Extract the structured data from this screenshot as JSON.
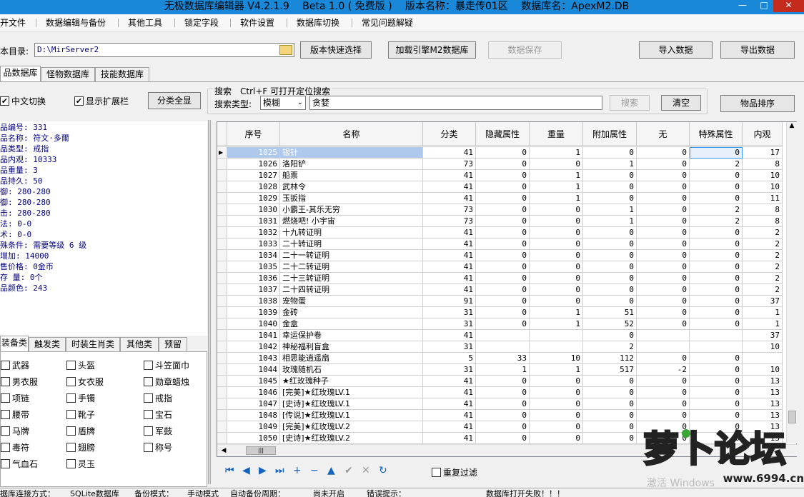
{
  "window": {
    "title": "无极数据库编辑器 V4.2.1.9　 Beta 1.0 ( 免费版 )　 版本名称：暴走传01区　 数据库名：ApexM2.DB",
    "minimize": "—",
    "maximize": "□",
    "close": "✕"
  },
  "menu": [
    "开文件",
    "数据编辑与备份",
    "其他工具",
    "锁定字段",
    "软件设置",
    "数据库切换",
    "常见问题解疑"
  ],
  "toolbar": {
    "dir_label": "本目录:",
    "dir_value": "D:\\MirServer2",
    "version_button": "版本快速选择",
    "load_button": "加载引擎M2数据库",
    "save_button": "数据保存",
    "import_button": "导入数据",
    "export_button": "导出数据"
  },
  "db_tabs": [
    "品数据库",
    "怪物数据库",
    "技能数据库"
  ],
  "options": {
    "chinese_toggle": "中文切换",
    "show_ext": "显示扩展栏",
    "expand_all": "分类全显"
  },
  "search": {
    "group_label": "搜索　Ctrl+F 可打开定位搜索",
    "type_label": "搜索类型:",
    "type_value": "模糊",
    "keyword": "贪婪",
    "search_button": "搜索",
    "clear_button": "清空",
    "sort_button": "物品排序"
  },
  "item_info": [
    "品编号: 331",
    "品名称: 符文·多爾",
    "品类型: 戒指",
    "品内观: 10333",
    "品重量: 3",
    "品持久: 50",
    "   御: 280-280",
    "   御: 280-280",
    "   击: 280-280",
    "   法: 0-0",
    "   术: 0-0",
    "殊条件: 需要等级 6 级",
    "  增加: 14000",
    "售价格: 0金币",
    " 存 量: 0个",
    "品颜色: 243"
  ],
  "category_tabs": [
    "装备类",
    "触发类",
    "时装生肖类",
    "其他类",
    "预留"
  ],
  "categories": [
    [
      "武器",
      "头盔",
      "斗笠面巾"
    ],
    [
      "男衣服",
      "女衣服",
      "勋章蜡烛"
    ],
    [
      "项链",
      "手镯",
      "戒指"
    ],
    [
      "腰带",
      "靴子",
      "宝石"
    ],
    [
      "马牌",
      "盾牌",
      "军鼓"
    ],
    [
      "毒符",
      "翅膀",
      "称号"
    ],
    [
      "气血石",
      "灵玉",
      ""
    ]
  ],
  "columns": [
    "序号",
    "名称",
    "分类",
    "隐藏属性",
    "重量",
    "附加属性",
    "无",
    "特殊属性",
    "内观"
  ],
  "rows": [
    [
      "1025",
      "银针",
      "41",
      "0",
      "1",
      "0",
      "0",
      "0",
      "17"
    ],
    [
      "1026",
      "洛阳铲",
      "73",
      "0",
      "0",
      "1",
      "0",
      "2",
      "8"
    ],
    [
      "1027",
      "船票",
      "41",
      "0",
      "1",
      "0",
      "0",
      "0",
      "10"
    ],
    [
      "1028",
      "武林令",
      "41",
      "0",
      "1",
      "0",
      "0",
      "0",
      "10"
    ],
    [
      "1029",
      "玉扳指",
      "41",
      "0",
      "1",
      "0",
      "0",
      "0",
      "11"
    ],
    [
      "1030",
      "小霸王-其乐无穷",
      "73",
      "0",
      "0",
      "1",
      "0",
      "2",
      "8"
    ],
    [
      "1031",
      "燃烧吧! 小宇宙",
      "73",
      "0",
      "0",
      "1",
      "0",
      "2",
      "8"
    ],
    [
      "1032",
      "十九转证明",
      "41",
      "0",
      "0",
      "0",
      "0",
      "0",
      "2"
    ],
    [
      "1033",
      "二十转证明",
      "41",
      "0",
      "0",
      "0",
      "0",
      "0",
      "2"
    ],
    [
      "1034",
      "二十一转证明",
      "41",
      "0",
      "0",
      "0",
      "0",
      "0",
      "2"
    ],
    [
      "1035",
      "二十二转证明",
      "41",
      "0",
      "0",
      "0",
      "0",
      "0",
      "2"
    ],
    [
      "1036",
      "二十三转证明",
      "41",
      "0",
      "0",
      "0",
      "0",
      "0",
      "2"
    ],
    [
      "1037",
      "二十四转证明",
      "41",
      "0",
      "0",
      "0",
      "0",
      "0",
      "2"
    ],
    [
      "1038",
      "宠物蛋",
      "91",
      "0",
      "0",
      "0",
      "0",
      "0",
      "37"
    ],
    [
      "1039",
      "金砖",
      "31",
      "0",
      "1",
      "51",
      "0",
      "0",
      "1"
    ],
    [
      "1040",
      "金盒",
      "31",
      "0",
      "1",
      "52",
      "0",
      "0",
      "1"
    ],
    [
      "1041",
      "幸运保护卷",
      "41",
      "",
      "",
      "0",
      "",
      "",
      "37"
    ],
    [
      "1042",
      "神秘福利盲盒",
      "31",
      "",
      "",
      "2",
      "",
      "",
      "10"
    ],
    [
      "1043",
      "相思能逍遥扇",
      "5",
      "33",
      "10",
      "112",
      "0",
      "0",
      ""
    ],
    [
      "1044",
      "玫瑰随机石",
      "31",
      "1",
      "1",
      "517",
      "-2",
      "0",
      "10"
    ],
    [
      "1045",
      "★红玫瑰种子",
      "41",
      "0",
      "0",
      "0",
      "0",
      "0",
      "13"
    ],
    [
      "1046",
      "[完美]★红玫瑰LV.1",
      "41",
      "0",
      "0",
      "0",
      "0",
      "0",
      "13"
    ],
    [
      "1047",
      "[史诗]★红玫瑰LV.1",
      "41",
      "0",
      "0",
      "0",
      "0",
      "0",
      "13"
    ],
    [
      "1048",
      "[传说]★红玫瑰LV.1",
      "41",
      "0",
      "0",
      "0",
      "0",
      "0",
      "13"
    ],
    [
      "1049",
      "[完美]★红玫瑰LV.2",
      "41",
      "0",
      "0",
      "0",
      "0",
      "0",
      "13"
    ],
    [
      "1050",
      "[史诗]★红玫瑰LV.2",
      "41",
      "0",
      "0",
      "0",
      "0",
      "0",
      "13"
    ]
  ],
  "nav_icons": [
    "first-icon",
    "prev-icon",
    "next-icon",
    "last-icon",
    "add-icon",
    "delete-icon",
    "up-icon",
    "confirm-icon",
    "cancel-icon",
    "refresh-icon"
  ],
  "nav_glyphs": [
    "⏮",
    "◀",
    "▶",
    "⏭",
    "+",
    "−",
    "▲",
    "✔",
    "✕",
    "↻"
  ],
  "repeat_filter": "重复过滤",
  "status": [
    "据库连接方式：",
    "SQLite数据库",
    "备份模式：",
    "手动模式",
    "自动备份周期：",
    "尚未开启",
    "错误提示：",
    "数据库打开失败！！！"
  ],
  "watermark": "激活 Windows",
  "logo": {
    "text": "萝卜论坛",
    "url": "www.6994.cn"
  },
  "colors": {
    "titlebar": "#1a88d8",
    "selection": "#aec9ec",
    "logo": "#ff8c00"
  }
}
